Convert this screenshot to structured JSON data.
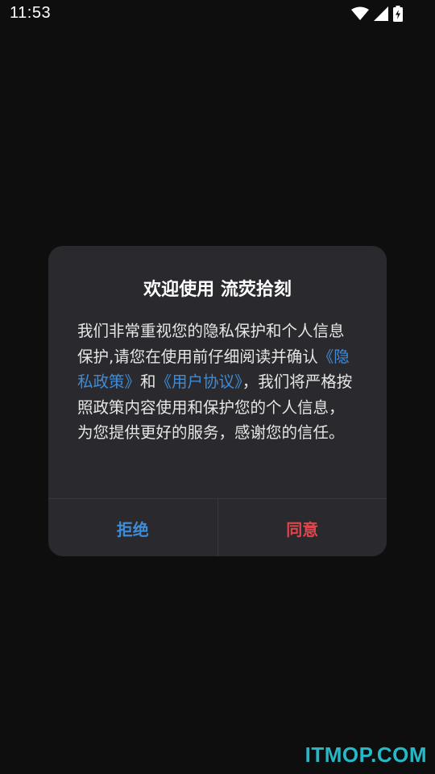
{
  "status_bar": {
    "time": "11:53",
    "icons": [
      "wifi-icon",
      "cellular-signal-icon",
      "battery-charging-icon"
    ]
  },
  "dialog": {
    "title": "欢迎使用 流荧拾刻",
    "body": {
      "text_before": "我们非常重视您的隐私保护和个人信息保护,请您在使用前仔细阅读并确认",
      "privacy_link": "《隐私政策》",
      "connector": "和",
      "agreement_link": "《用户协议》",
      "text_after": "，我们将严格按照政策内容使用和保护您的个人信息，为您提供更好的服务，感谢您的信任。"
    },
    "buttons": {
      "reject_label": "拒绝",
      "agree_label": "同意"
    }
  },
  "colors": {
    "background": "#0e0e0e",
    "dialog": "#2a2a2e",
    "link": "#3f8bd6",
    "reject": "#3f8bd6",
    "agree": "#e0454c",
    "watermark": "#27b8c8"
  },
  "watermark": "ITMOP.COM"
}
